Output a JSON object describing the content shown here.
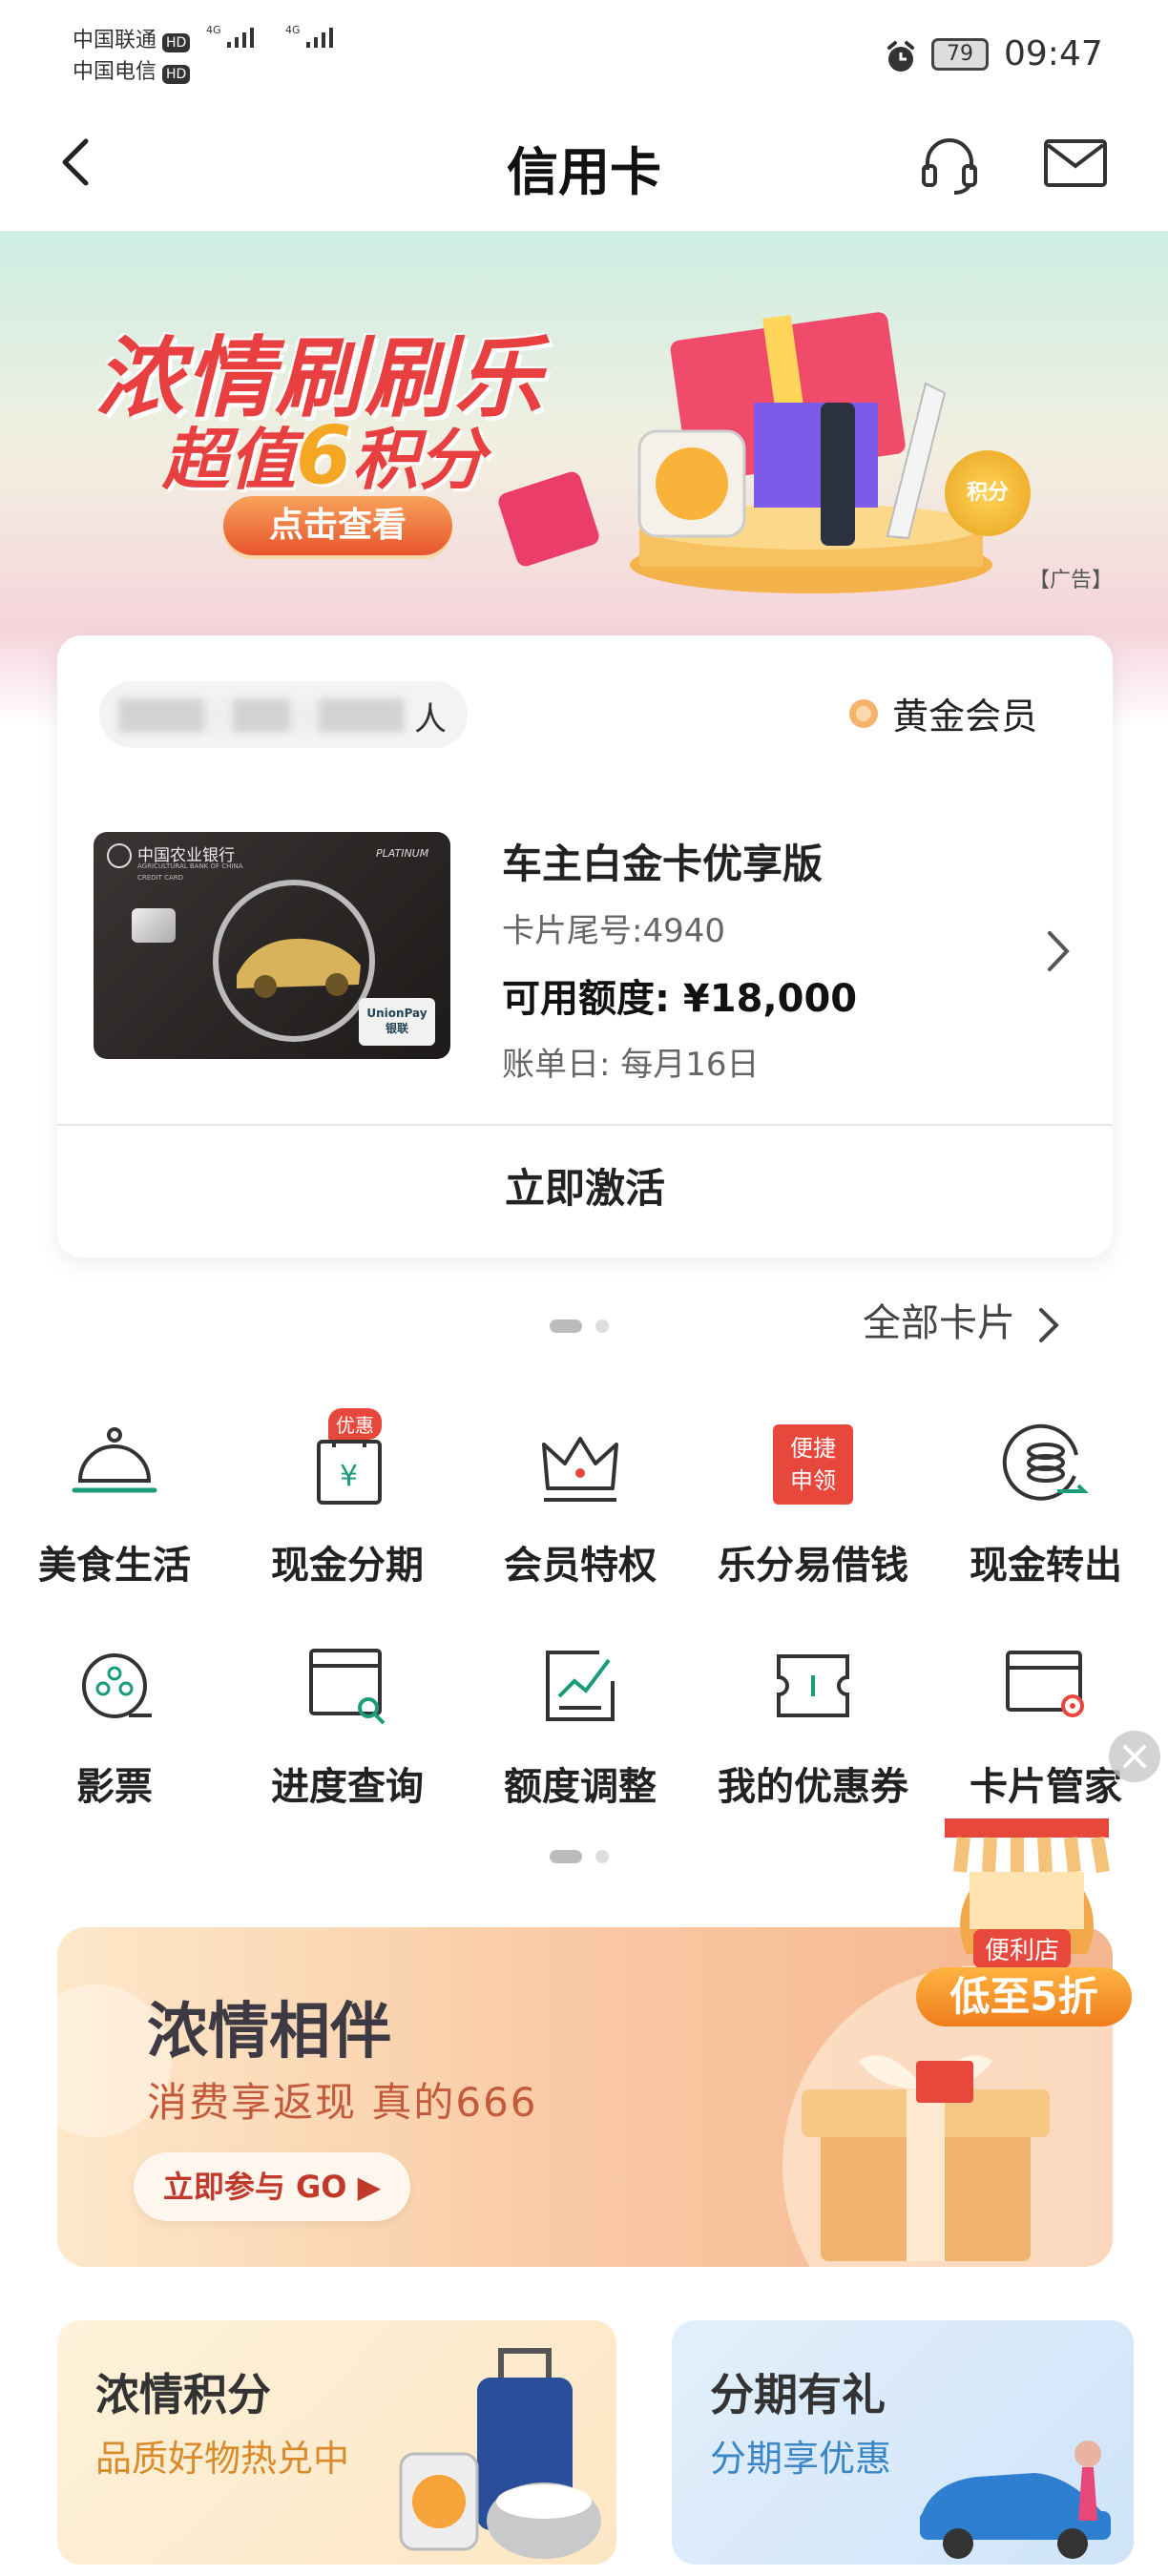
{
  "status_bar": {
    "carrier_1": "中国联通",
    "carrier_2": "中国电信",
    "hd": "HD",
    "net": "4G",
    "battery": "79",
    "time": "09:47"
  },
  "header": {
    "title": "信用卡"
  },
  "banner": {
    "headline": "浓情刷刷乐",
    "subline_prefix": "超值",
    "subline_num": "6",
    "subline_suffix": "积分",
    "cta": "点击查看",
    "coin": "积分",
    "ad_tag": "【广告】"
  },
  "card": {
    "holder_suffix": "人",
    "member_level": "黄金会员",
    "bank_name": "中国农业银行",
    "bank_name_en": "AGRICULTURAL BANK OF CHINA",
    "card_tier": "PLATINUM",
    "card_type_label": "CREDIT CARD",
    "unionpay": "UnionPay",
    "unionpay_cn": "银联",
    "product_name": "车主白金卡优享版",
    "tail_label": "卡片尾号:4940",
    "limit_label": "可用额度: ¥18,000",
    "bill_label": "账单日: 每月16日",
    "activate": "立即激活"
  },
  "all_cards": "全部卡片",
  "menu_row1": [
    {
      "label": "美食生活",
      "icon": "food-cloche-icon"
    },
    {
      "label": "现金分期",
      "icon": "cash-installment-icon",
      "badge": "优惠"
    },
    {
      "label": "会员特权",
      "icon": "crown-icon"
    },
    {
      "label": "乐分易借钱",
      "icon": "loan-icon",
      "tag_1": "便捷",
      "tag_2": "申领"
    },
    {
      "label": "现金转出",
      "icon": "coin-transfer-icon"
    }
  ],
  "menu_row2": [
    {
      "label": "影票",
      "icon": "film-reel-icon"
    },
    {
      "label": "进度查询",
      "icon": "progress-search-icon"
    },
    {
      "label": "额度调整",
      "icon": "limit-adjust-icon"
    },
    {
      "label": "我的优惠券",
      "icon": "coupon-icon"
    },
    {
      "label": "卡片管家",
      "icon": "card-settings-icon"
    }
  ],
  "promo": {
    "title": "浓情相伴",
    "subtitle": "消费享返现 真的666",
    "cta": "立即参与 GO ▶"
  },
  "store_float": {
    "sign": "便利店",
    "deal": "低至5折"
  },
  "bottom_cards": [
    {
      "title": "浓情积分",
      "subtitle": "品质好物热兑中"
    },
    {
      "title": "分期有礼",
      "subtitle": "分期享优惠"
    }
  ],
  "colors": {
    "accent_green": "#1a9b7a",
    "promo_red": "#e8473c",
    "gold": "#f2b35b"
  }
}
